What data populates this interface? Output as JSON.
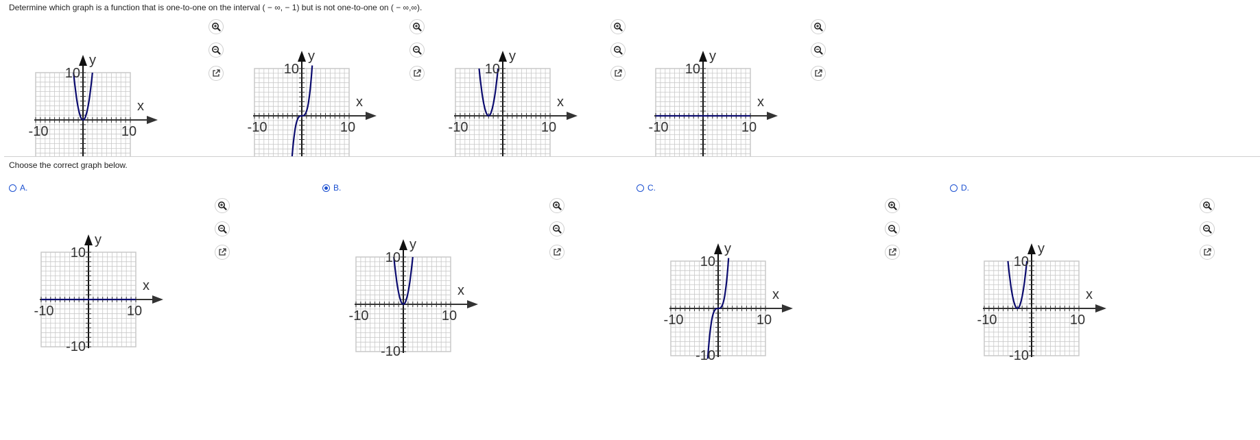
{
  "question": "Determine which graph is a function that is one-to-one on the interval ( − ∞, − 1) but is not one-to-one on ( − ∞,∞).",
  "prompt": "Choose the correct graph below.",
  "axis": {
    "x_label": "x",
    "y_label": "y",
    "tick_neg": "-10",
    "tick_pos": "10"
  },
  "icons": {
    "zoom_in": "zoom-in-icon",
    "zoom_out": "zoom-out-icon",
    "open": "open-external-icon"
  },
  "colors": {
    "curve": "#0b0b6e",
    "grid": "#c8c8c8",
    "option": "#1a4fd0"
  },
  "options": [
    {
      "letter": "A.",
      "selected": false
    },
    {
      "letter": "B.",
      "selected": true
    },
    {
      "letter": "C.",
      "selected": false
    },
    {
      "letter": "D.",
      "selected": false
    }
  ],
  "chart_data": [
    {
      "id": "top-1",
      "type": "line",
      "curve": "parabola",
      "vertex": [
        0,
        0
      ],
      "xlim": [
        -10,
        10
      ],
      "ylim": [
        -10,
        10
      ]
    },
    {
      "id": "top-2",
      "type": "line",
      "curve": "cubic",
      "xlim": [
        -10,
        10
      ],
      "ylim": [
        -10,
        10
      ]
    },
    {
      "id": "top-3",
      "type": "line",
      "curve": "parabola",
      "vertex": [
        -3,
        0
      ],
      "xlim": [
        -10,
        10
      ],
      "ylim": [
        -10,
        10
      ]
    },
    {
      "id": "top-4",
      "type": "line",
      "curve": "constant",
      "value": 0,
      "xlim": [
        -10,
        10
      ],
      "ylim": [
        -10,
        10
      ]
    },
    {
      "id": "option-a",
      "type": "line",
      "curve": "constant",
      "value": 0,
      "xlim": [
        -10,
        10
      ],
      "ylim": [
        -10,
        10
      ]
    },
    {
      "id": "option-b",
      "type": "line",
      "curve": "parabola",
      "vertex": [
        0,
        0
      ],
      "xlim": [
        -10,
        10
      ],
      "ylim": [
        -10,
        10
      ]
    },
    {
      "id": "option-c",
      "type": "line",
      "curve": "cubic",
      "xlim": [
        -10,
        10
      ],
      "ylim": [
        -10,
        10
      ]
    },
    {
      "id": "option-d",
      "type": "line",
      "curve": "parabola",
      "vertex": [
        -3,
        0
      ],
      "xlim": [
        -10,
        10
      ],
      "ylim": [
        -10,
        10
      ]
    }
  ]
}
